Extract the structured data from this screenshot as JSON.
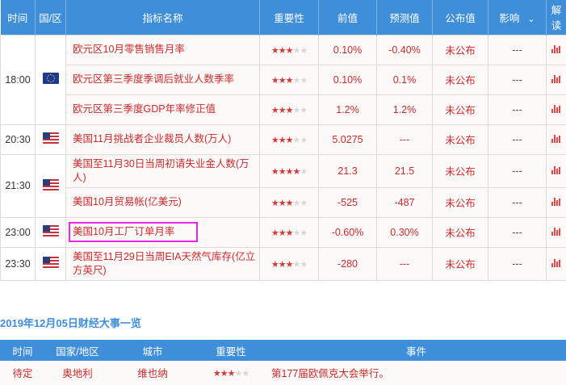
{
  "calendar": {
    "headers": {
      "time": "时间",
      "region": "国/区",
      "indicator": "指标名称",
      "importance": "重要性",
      "previous": "前值",
      "forecast": "预测值",
      "actual": "公布值",
      "impact": "影响",
      "analysis": "解读"
    },
    "groups": [
      {
        "time": "18:00",
        "flag": "eu-flag-icon",
        "rows": [
          {
            "name": "欧元区10月零售销售月率",
            "stars": 3,
            "previous": "0.10%",
            "forecast": "-0.40%",
            "actual": "未公布",
            "impact": "---"
          },
          {
            "name": "欧元区第三季度季调后就业人数季率",
            "stars": 3,
            "previous": "0.10%",
            "forecast": "0.1%",
            "actual": "未公布",
            "impact": "---"
          },
          {
            "name": "欧元区第三季度GDP年率修正值",
            "stars": 3,
            "previous": "1.2%",
            "forecast": "1.2%",
            "actual": "未公布",
            "impact": "---"
          }
        ]
      },
      {
        "time": "20:30",
        "flag": "us-flag-icon",
        "rows": [
          {
            "name": "美国11月挑战者企业裁员人数(万人)",
            "stars": 3,
            "previous": "5.0275",
            "forecast": "---",
            "actual": "未公布",
            "impact": "---"
          }
        ]
      },
      {
        "time": "21:30",
        "flag": "us-flag-icon",
        "rows": [
          {
            "name": "美国至11月30日当周初请失业金人数(万人)",
            "stars": 4,
            "previous": "21.3",
            "forecast": "21.5",
            "actual": "未公布",
            "impact": "---"
          },
          {
            "name": "美国10月贸易帐(亿美元)",
            "stars": 3,
            "previous": "-525",
            "forecast": "-487",
            "actual": "未公布",
            "impact": "---"
          }
        ]
      },
      {
        "time": "23:00",
        "flag": "us-flag-icon",
        "rows": [
          {
            "name": "美国10月工厂订单月率",
            "stars": 3,
            "previous": "-0.60%",
            "forecast": "0.30%",
            "actual": "未公布",
            "impact": "---",
            "highlighted": true
          }
        ]
      },
      {
        "time": "23:30",
        "flag": "us-flag-icon",
        "rows": [
          {
            "name": "美国至11月29日当周EIA天然气库存(亿立方英尺)",
            "stars": 3,
            "previous": "-280",
            "forecast": "---",
            "actual": "未公布",
            "impact": "---"
          }
        ]
      }
    ]
  },
  "events_section": {
    "title": "2019年12月05日财经大事一览",
    "headers": {
      "time": "时间",
      "country": "国家/地区",
      "city": "城市",
      "importance": "重要性",
      "event": "事件"
    },
    "rows": [
      {
        "time": "待定",
        "country": "奥地利",
        "city": "维也纳",
        "stars": 3,
        "event": "第177届欧佩克大会举行。"
      }
    ]
  },
  "colors": {
    "header_bg": "#3f8ed9",
    "accent_red": "#cc2a2a",
    "highlight": "#e826e8"
  }
}
